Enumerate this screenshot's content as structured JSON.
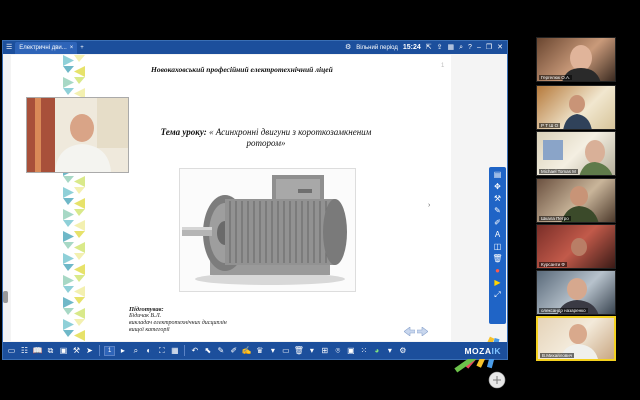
{
  "window": {
    "tab_title": "Електричні дви...",
    "tab_close": "×",
    "tab_add": "+",
    "app_title": "Вільний період",
    "clock": "15:24"
  },
  "slide": {
    "lyceum_title": "Новокаховський професійний електротехнічний ліцей",
    "page_mark": "1",
    "topic_label": "Тема уроку:",
    "topic_text": " « Асинхронні двигуни з короткозамкненим ротором»",
    "prepared_label": "Підготував:",
    "prepared_name": "Бідичак В.Л.",
    "prepared_role_1": "викладач електротехнічних дисциплін",
    "prepared_role_2": "вищої категорії",
    "right_arrow": "›"
  },
  "bottom_toolbar": {
    "page_value": "1"
  },
  "brand": {
    "logo_main": "MOZA",
    "logo_accent": "IK"
  },
  "participants": [
    {
      "name": "Гергелюк О.А."
    },
    {
      "name": "Р Т Ш О"
    },
    {
      "name": "Michael Tomas M"
    },
    {
      "name": "Шкала Петро"
    },
    {
      "name": "Курсанти Ф"
    },
    {
      "name": "олександр назаренко"
    },
    {
      "name": "В.Михайлович"
    }
  ],
  "colors": {
    "toolbar_blue": "#1c4f9c",
    "side_toolbar_blue": "#1f64c6",
    "active_border": "#f4d11f"
  }
}
